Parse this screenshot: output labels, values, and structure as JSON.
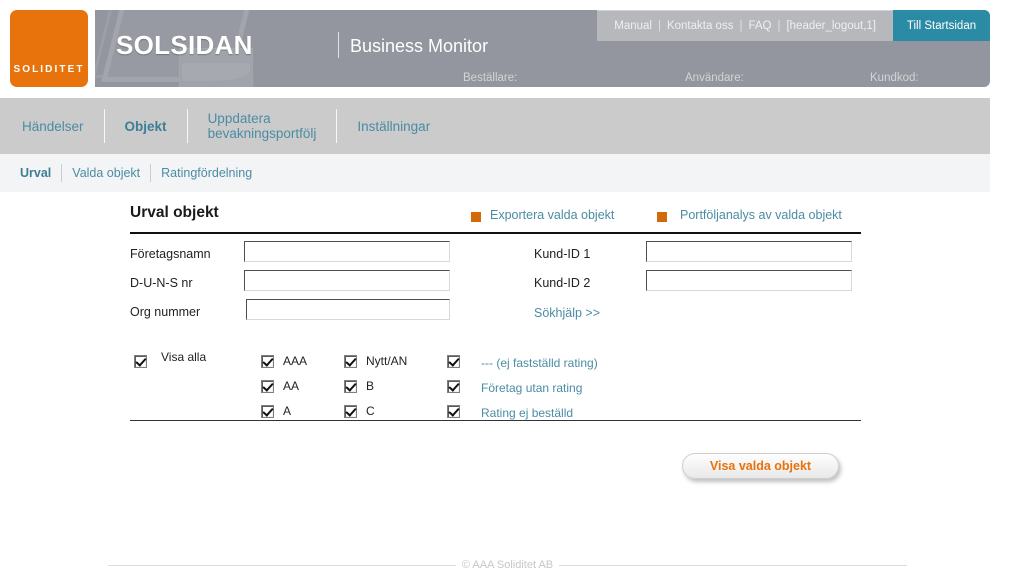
{
  "brand": {
    "logo_text": "SOLIDITET",
    "name": "SOLSIDAN",
    "subtitle": "Business Monitor"
  },
  "header": {
    "links": [
      {
        "label": "Manual"
      },
      {
        "label": "Kontakta oss"
      },
      {
        "label": "FAQ"
      },
      {
        "label": "[header_logout,1]"
      }
    ],
    "separator": "|",
    "start_button": "Till Startsidan",
    "meta": [
      {
        "label": "Beställare:",
        "value": ""
      },
      {
        "label": "Användare:",
        "value": ""
      },
      {
        "label": "Kundkod:",
        "value": ""
      }
    ]
  },
  "nav": {
    "items": [
      {
        "label": "Händelser",
        "active": false
      },
      {
        "label": "Objekt",
        "active": true
      },
      {
        "label": "Uppdatera\nbevakningsportfölj",
        "active": false
      },
      {
        "label": "Inställningar",
        "active": false
      }
    ]
  },
  "subnav": {
    "items": [
      {
        "label": "Urval",
        "active": true
      },
      {
        "label": "Valda objekt",
        "active": false
      },
      {
        "label": "Ratingfördelning",
        "active": false
      }
    ]
  },
  "main": {
    "title": "Urval objekt",
    "actions": [
      {
        "label": "Exportera valda objekt",
        "bullet_color": "#d2690a"
      },
      {
        "label": "Portföljanalys av valda objekt",
        "bullet_color": "#d2690a"
      }
    ],
    "fields_left": [
      {
        "label": "Företagsnamn",
        "value": "",
        "placeholder": ""
      },
      {
        "label": "D-U-N-S nr",
        "value": "",
        "placeholder": ""
      },
      {
        "label": "Org nummer",
        "value": "",
        "placeholder": ""
      }
    ],
    "fields_right": [
      {
        "label": "Kund-ID 1",
        "value": "",
        "placeholder": ""
      },
      {
        "label": "Kund-ID 2",
        "value": "",
        "placeholder": ""
      }
    ],
    "help_link": "Sökhjälp >>",
    "show_all": {
      "label": "Visa alla",
      "checked": true
    },
    "rating_columns": [
      {
        "items": [
          {
            "label": "AAA",
            "checked": true,
            "is_link": false
          },
          {
            "label": "AA",
            "checked": true,
            "is_link": false
          },
          {
            "label": "A",
            "checked": true,
            "is_link": false
          }
        ]
      },
      {
        "items": [
          {
            "label": "Nytt/AN",
            "checked": true,
            "is_link": false
          },
          {
            "label": "B",
            "checked": true,
            "is_link": false
          },
          {
            "label": "C",
            "checked": true,
            "is_link": false
          }
        ]
      },
      {
        "items": [
          {
            "label": "--- (ej fastställd rating)",
            "checked": true,
            "is_link": true
          },
          {
            "label": "Företag utan rating",
            "checked": true,
            "is_link": true
          },
          {
            "label": "Rating ej beställd",
            "checked": true,
            "is_link": true
          }
        ]
      }
    ],
    "submit_button": "Visa valda objekt"
  },
  "footer": {
    "copyright": "© AAA Soliditet AB"
  },
  "colors": {
    "brand_orange": "#e8720c",
    "accent_teal": "#2c8ba4",
    "link_blue": "#4b8ca3",
    "header_gray": "#93969e",
    "nav_gray": "#cbcbcb",
    "subnav_gray": "#f3f4f6",
    "bullet_orange": "#d2690a"
  }
}
